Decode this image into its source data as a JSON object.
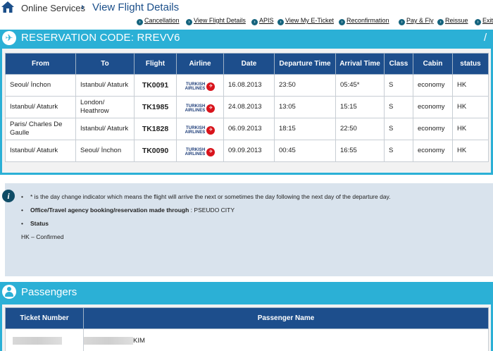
{
  "breadcrumb": {
    "root": "Online Services",
    "current": "View Flight Details"
  },
  "actions": [
    "Cancellation",
    "View Flight Details",
    "APIS",
    "View My E-Ticket",
    "Reconfirmation",
    "Pay & Fly",
    "Reissue",
    "Exit"
  ],
  "reservation": {
    "label": "RESERVATION CODE: RREVV6",
    "end_mark": "/"
  },
  "flights": {
    "headers": [
      "From",
      "To",
      "Flight",
      "Airline",
      "Date",
      "Departure Time",
      "Arrival Time",
      "Class",
      "Cabin",
      "status"
    ],
    "airline_logo": {
      "line1": "TURKISH",
      "line2": "AIRLINES"
    },
    "rows": [
      {
        "from": "Seoul/ İnchon",
        "to": "Istanbul/ Ataturk",
        "flight": "TK0091",
        "date": "16.08.2013",
        "dep": "23:50",
        "arr": "05:45*",
        "class": "S",
        "cabin": "economy",
        "status": "HK"
      },
      {
        "from": "Istanbul/ Ataturk",
        "to": "London/ Heathrow",
        "flight": "TK1985",
        "date": "24.08.2013",
        "dep": "13:05",
        "arr": "15:15",
        "class": "S",
        "cabin": "economy",
        "status": "HK"
      },
      {
        "from": "Paris/ Charles De Gaulle",
        "to": "Istanbul/ Ataturk",
        "flight": "TK1828",
        "date": "06.09.2013",
        "dep": "18:15",
        "arr": "22:50",
        "class": "S",
        "cabin": "economy",
        "status": "HK"
      },
      {
        "from": "Istanbul/ Ataturk",
        "to": "Seoul/ İnchon",
        "flight": "TK0090",
        "date": "09.09.2013",
        "dep": "00:45",
        "arr": "16:55",
        "class": "S",
        "cabin": "economy",
        "status": "HK"
      }
    ]
  },
  "info": {
    "note": "* is the day change indicator which means the flight will arrive the next or sometimes the day following the next day of the departure day.",
    "office_label": "Office/Travel agency booking/reservation made through",
    "office_sep": " : ",
    "office_value": "PSEUDO CITY",
    "status_label": "Status",
    "status_value": "HK – Confirmed",
    "bullet": "•"
  },
  "passengers": {
    "title": "Passengers",
    "headers": [
      "Ticket Number",
      "Passenger Name"
    ],
    "row": {
      "name_suffix": "KIM"
    }
  },
  "colors": {
    "accent": "#2bb0d6",
    "header_bg": "#1d4e8c",
    "info_bg": "#d9e3ed",
    "airline_red": "#d8141c"
  }
}
